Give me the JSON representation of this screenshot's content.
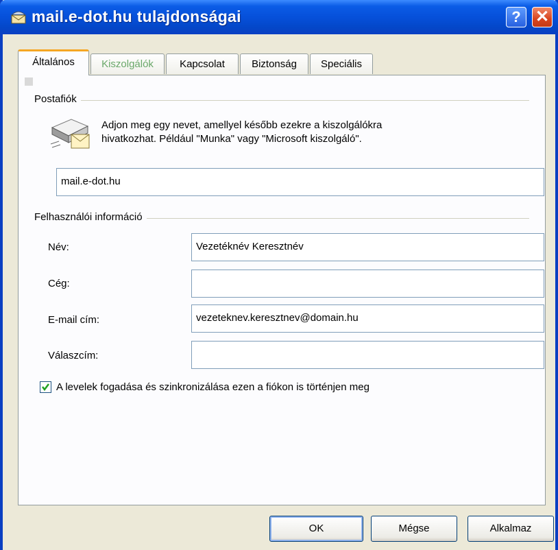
{
  "window": {
    "title": "mail.e-dot.hu tulajdonságai",
    "help_glyph": "?",
    "close_glyph": "✕"
  },
  "tabs": [
    {
      "label": "Általános",
      "active": true
    },
    {
      "label": "Kiszolgálók",
      "disabled": true
    },
    {
      "label": "Kapcsolat"
    },
    {
      "label": "Biztonság"
    },
    {
      "label": "Speciális"
    }
  ],
  "postafiok": {
    "group_label": "Postafiók",
    "icon": "mail-server-icon",
    "description_line1": "Adjon meg egy nevet, amellyel később ezekre a kiszolgálókra",
    "description_line2": "hivatkozhat. Például \"Munka\" vagy \"Microsoft kiszolgáló\".",
    "account_name": "mail.e-dot.hu"
  },
  "user_info": {
    "group_label": "Felhasználói információ",
    "name_label": "Név:",
    "name_value": "Vezetéknév Keresztnév",
    "company_label": "Cég:",
    "company_value": "",
    "email_label": "E-mail cím:",
    "email_value": "vezeteknev.keresztnev@domain.hu",
    "reply_label": "Válaszcím:",
    "reply_value": ""
  },
  "sync_checkbox": {
    "checked": true,
    "label": "A levelek fogadása és szinkronizálása ezen a fiókon is történjen meg"
  },
  "buttons": {
    "ok": "OK",
    "cancel": "Mégse",
    "apply": "Alkalmaz"
  }
}
